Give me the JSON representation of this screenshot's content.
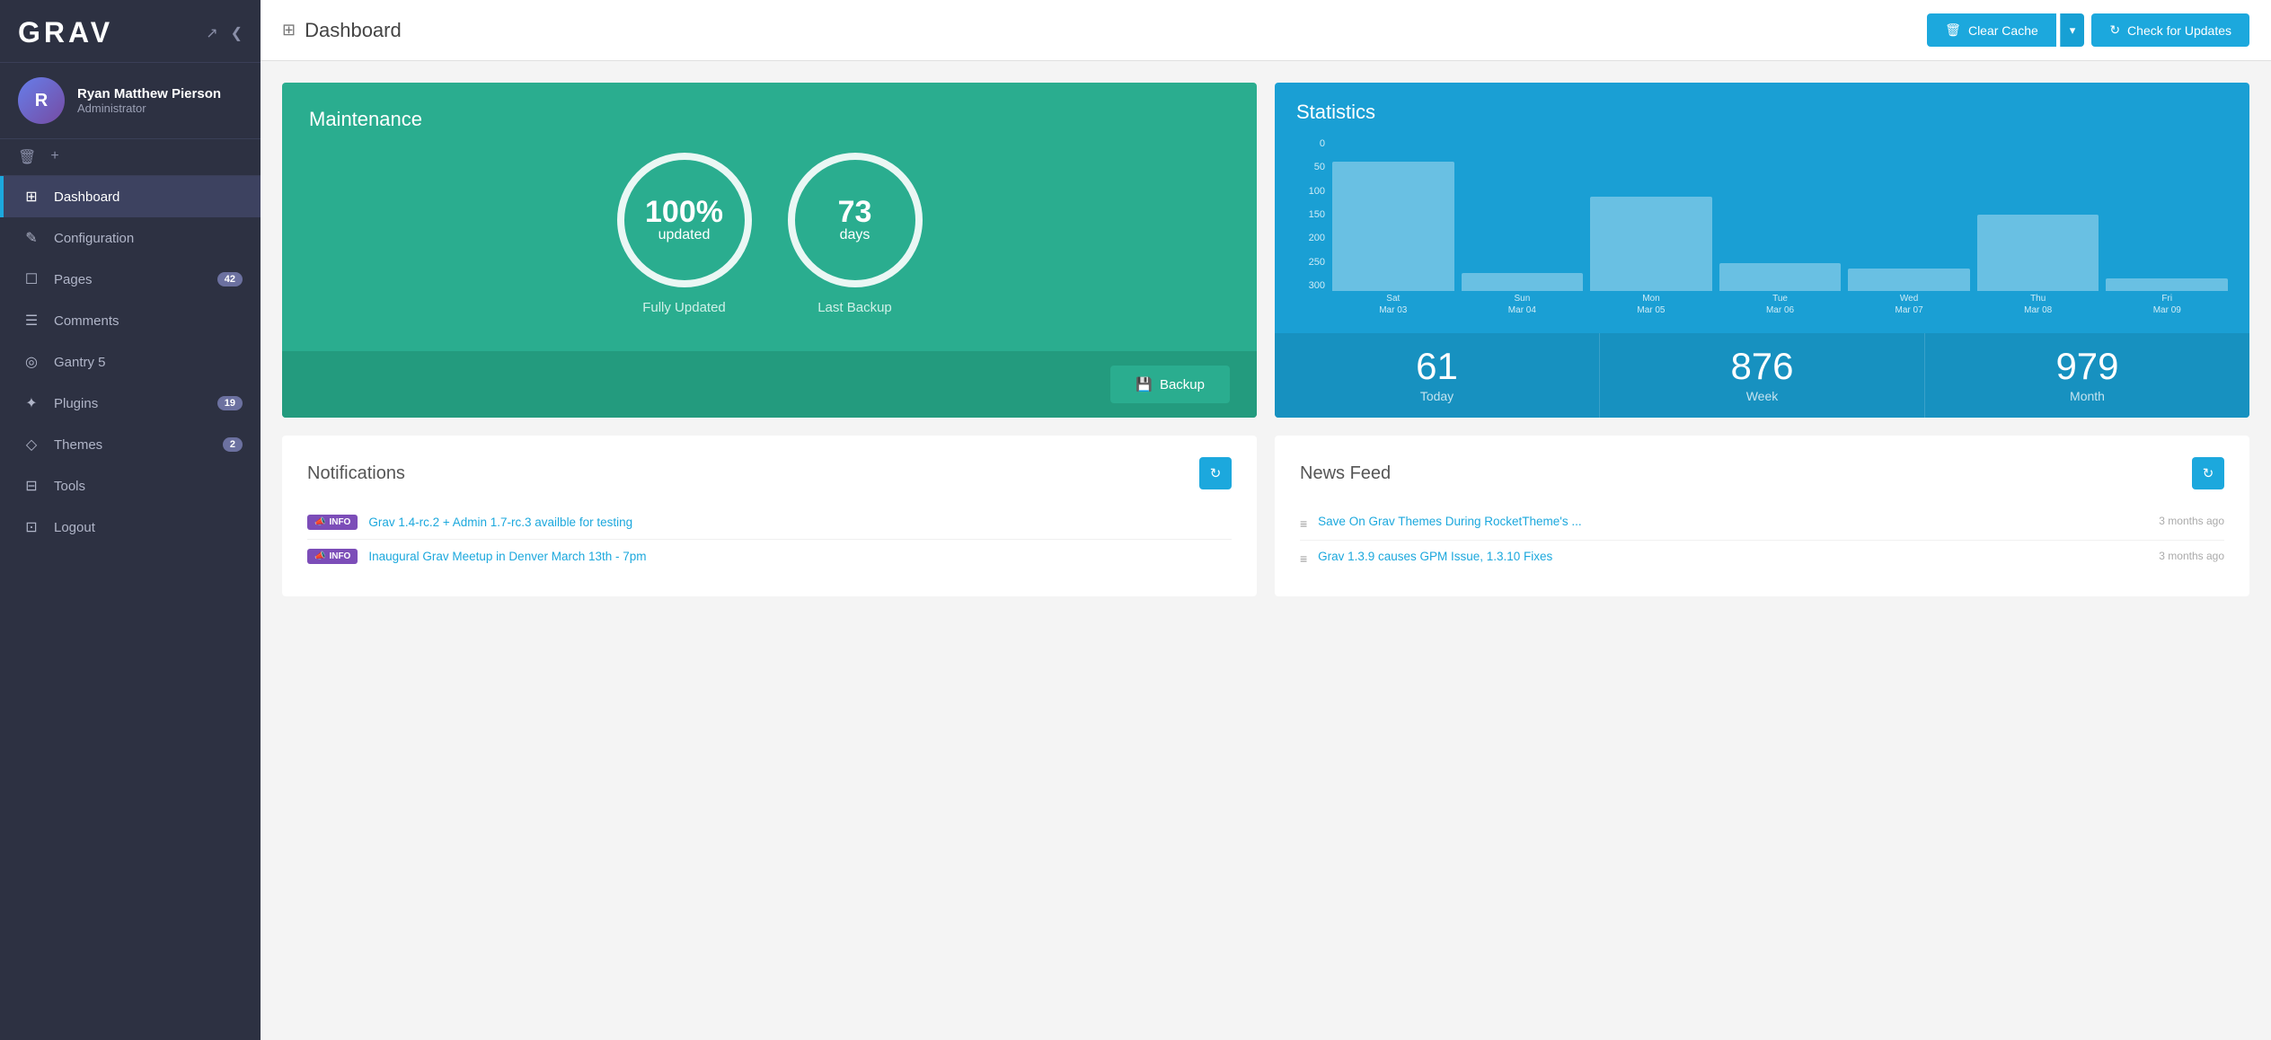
{
  "sidebar": {
    "logo": "GRAV",
    "user": {
      "name": "Ryan Matthew Pierson",
      "role": "Administrator",
      "avatar_initials": "R"
    },
    "nav_items": [
      {
        "id": "dashboard",
        "label": "Dashboard",
        "icon": "⊞",
        "active": true,
        "badge": null
      },
      {
        "id": "configuration",
        "label": "Configuration",
        "icon": "✎",
        "active": false,
        "badge": null
      },
      {
        "id": "pages",
        "label": "Pages",
        "icon": "☐",
        "active": false,
        "badge": "42"
      },
      {
        "id": "comments",
        "label": "Comments",
        "icon": "☰",
        "active": false,
        "badge": null
      },
      {
        "id": "gantry5",
        "label": "Gantry 5",
        "icon": "◎",
        "active": false,
        "badge": null
      },
      {
        "id": "plugins",
        "label": "Plugins",
        "icon": "✦",
        "active": false,
        "badge": "19"
      },
      {
        "id": "themes",
        "label": "Themes",
        "icon": "◇",
        "active": false,
        "badge": "2"
      },
      {
        "id": "tools",
        "label": "Tools",
        "icon": "⊟",
        "active": false,
        "badge": null
      },
      {
        "id": "logout",
        "label": "Logout",
        "icon": "⊡",
        "active": false,
        "badge": null
      }
    ]
  },
  "topbar": {
    "title": "Dashboard",
    "grid_icon": "⊞",
    "btn_clear_cache": "Clear Cache",
    "btn_check_updates": "Check for Updates"
  },
  "maintenance": {
    "title": "Maintenance",
    "circle1_value": "100%",
    "circle1_unit": "updated",
    "circle1_label": "Fully Updated",
    "circle2_value": "73",
    "circle2_unit": "days",
    "circle2_label": "Last Backup",
    "btn_backup": "Backup"
  },
  "statistics": {
    "title": "Statistics",
    "chart": {
      "y_labels": [
        "300",
        "250",
        "200",
        "150",
        "100",
        "50",
        "0"
      ],
      "bars": [
        {
          "label": "Sat\nMar 03",
          "label_line1": "Sat",
          "label_line2": "Mar 03",
          "height_pct": 85
        },
        {
          "label": "Sun\nMar 04",
          "label_line1": "Sun",
          "label_line2": "Mar 04",
          "height_pct": 12
        },
        {
          "label": "Mon\nMar 05",
          "label_line1": "Mon",
          "label_line2": "Mar 05",
          "height_pct": 62
        },
        {
          "label": "Tue\nMar 06",
          "label_line1": "Tue",
          "label_line2": "Mar 06",
          "height_pct": 18
        },
        {
          "label": "Wed\nMar 07",
          "label_line1": "Wed",
          "label_line2": "Mar 07",
          "height_pct": 15
        },
        {
          "label": "Thu\nMar 08",
          "label_line1": "Thu",
          "label_line2": "Mar 08",
          "height_pct": 50
        },
        {
          "label": "Fri\nMar 09",
          "label_line1": "Fri",
          "label_line2": "Mar 09",
          "height_pct": 8
        }
      ]
    },
    "stats": [
      {
        "value": "61",
        "label": "Today"
      },
      {
        "value": "876",
        "label": "Week"
      },
      {
        "value": "979",
        "label": "Month"
      }
    ]
  },
  "notifications": {
    "title": "Notifications",
    "items": [
      {
        "badge": "INFO",
        "text": "Grav 1.4-rc.2 + Admin 1.7-rc.3 availble for testing"
      },
      {
        "badge": "INFO",
        "text": "Inaugural Grav Meetup in Denver March 13th - 7pm"
      }
    ]
  },
  "newsfeed": {
    "title": "News Feed",
    "items": [
      {
        "text": "Save On Grav Themes During RocketTheme's ...",
        "time": "3 months ago"
      },
      {
        "text": "Grav 1.3.9 causes GPM Issue, 1.3.10 Fixes",
        "time": "3 months ago"
      }
    ]
  }
}
